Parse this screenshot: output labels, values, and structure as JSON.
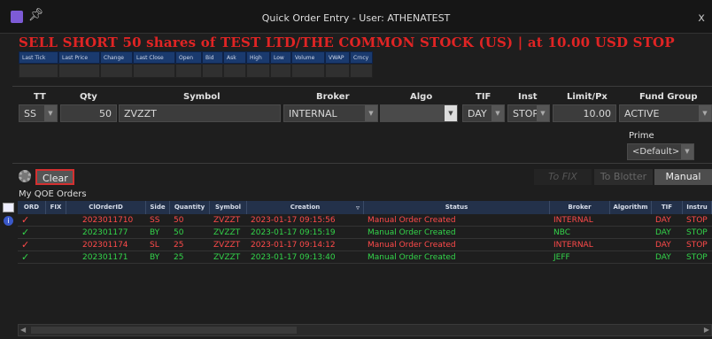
{
  "window": {
    "title": "Quick Order Entry - User: ATHENATEST",
    "close": "x"
  },
  "banner": "SELL SHORT 50 shares of TEST LTD/THE COMMON STOCK (US) | at 10.00 USD STOP",
  "market_headers": [
    "Last Tick",
    "Last Price",
    "Change",
    "Last Close",
    "Open",
    "Bid",
    "Ask",
    "High",
    "Low",
    "Volume",
    "VWAP",
    "Crncy"
  ],
  "order_form": {
    "labels": {
      "tt": "TT",
      "qty": "Qty",
      "symbol": "Symbol",
      "broker": "Broker",
      "algo": "Algo",
      "tif": "TIF",
      "inst": "Inst",
      "limitpx": "Limit/Px",
      "fund_group": "Fund Group",
      "prime": "Prime"
    },
    "values": {
      "tt": "SS",
      "qty": "50",
      "symbol": "ZVZZT",
      "broker": "INTERNAL",
      "algo": "",
      "tif": "DAY",
      "inst": "STOP",
      "limitpx": "10.00",
      "fund_group": "ACTIVE",
      "prime": "<Default>"
    }
  },
  "toolbar": {
    "clear": "Clear",
    "to_fix": "To FIX",
    "to_blotter": "To Blotter",
    "manual": "Manual"
  },
  "orders": {
    "title": "My QOE Orders",
    "columns": [
      "ORD",
      "FIX",
      "ClOrderID",
      "Side",
      "Quantity",
      "Symbol",
      "Creation",
      "Status",
      "Broker",
      "Algorithm",
      "TIF",
      "Instru"
    ],
    "rows": [
      {
        "ord": "✓",
        "fix": "",
        "cl_order_id": "2023011710",
        "side": "SS",
        "quantity": "50",
        "symbol": "ZVZZT",
        "creation": "2023-01-17 09:15:56",
        "status": "Manual Order Created",
        "broker": "INTERNAL",
        "algorithm": "",
        "tif": "DAY",
        "instru": "STOP",
        "color": "red"
      },
      {
        "ord": "✓",
        "fix": "",
        "cl_order_id": "202301177",
        "side": "BY",
        "quantity": "50",
        "symbol": "ZVZZT",
        "creation": "2023-01-17 09:15:19",
        "status": "Manual Order Created",
        "broker": "NBC",
        "algorithm": "",
        "tif": "DAY",
        "instru": "STOP",
        "color": "green"
      },
      {
        "ord": "✓",
        "fix": "",
        "cl_order_id": "202301174",
        "side": "SL",
        "quantity": "25",
        "symbol": "ZVZZT",
        "creation": "2023-01-17 09:14:12",
        "status": "Manual Order Created",
        "broker": "INTERNAL",
        "algorithm": "",
        "tif": "DAY",
        "instru": "STOP",
        "color": "red"
      },
      {
        "ord": "✓",
        "fix": "",
        "cl_order_id": "202301171",
        "side": "BY",
        "quantity": "25",
        "symbol": "ZVZZT",
        "creation": "2023-01-17 09:13:40",
        "status": "Manual Order Created",
        "broker": "JEFF",
        "algorithm": "",
        "tif": "DAY",
        "instru": "STOP",
        "color": "green"
      }
    ]
  },
  "colors": {
    "banner": "#e02424",
    "buy": "#33d44a",
    "sell": "#ff4a4a",
    "header_blue": "#23314a",
    "clear_border": "#d43030"
  }
}
